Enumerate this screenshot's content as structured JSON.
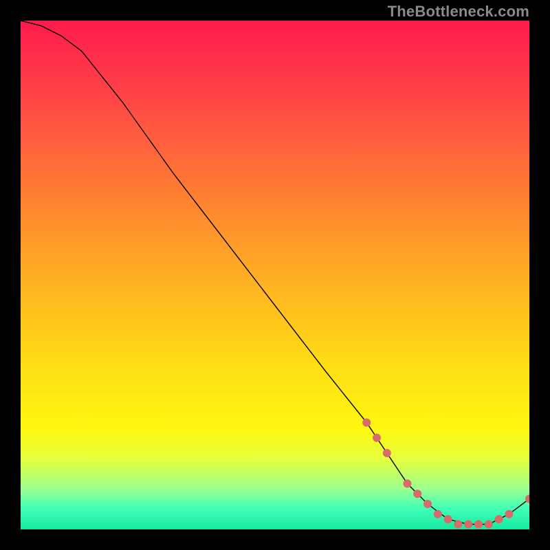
{
  "watermark": "TheBottleneck.com",
  "chart_data": {
    "type": "line",
    "title": "",
    "xlabel": "",
    "ylabel": "",
    "xlim": [
      0,
      100
    ],
    "ylim": [
      0,
      100
    ],
    "x": [
      0,
      4,
      8,
      12,
      20,
      30,
      40,
      50,
      60,
      68,
      72,
      76,
      80,
      84,
      88,
      92,
      96,
      100
    ],
    "values": [
      100,
      99,
      97,
      94,
      84,
      70,
      57,
      44,
      31,
      21,
      15,
      9,
      5,
      2,
      1,
      1,
      3,
      6
    ],
    "markers": {
      "x": [
        68,
        70,
        72,
        76,
        78,
        80,
        82,
        84,
        86,
        88,
        90,
        92,
        94,
        96,
        100
      ],
      "values": [
        21,
        18,
        15,
        9,
        7,
        5,
        3,
        2,
        1,
        1,
        1,
        1,
        2,
        3,
        6
      ],
      "color": "#d86a6a",
      "radius": 6
    }
  }
}
